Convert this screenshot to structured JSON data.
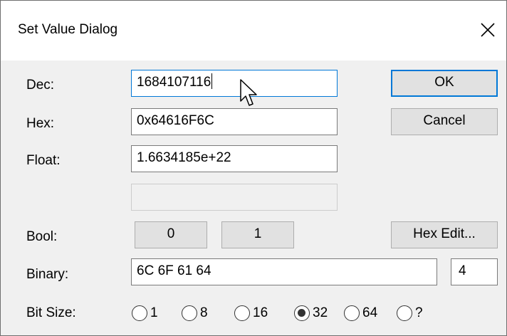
{
  "window": {
    "title": "Set Value Dialog",
    "close_icon": "close-icon"
  },
  "fields": {
    "dec": {
      "label": "Dec:",
      "value": "1684107116"
    },
    "hex": {
      "label": "Hex:",
      "value": "0x64616F6C"
    },
    "float": {
      "label": "Float:",
      "value": "1.6634185e+22"
    },
    "extra": {
      "value": ""
    },
    "bool": {
      "label": "Bool:",
      "false_label": "0",
      "true_label": "1"
    },
    "binary": {
      "label": "Binary:",
      "value": "6C 6F 61 64",
      "size": "4"
    },
    "bit_size": {
      "label": "Bit Size:",
      "options": [
        "1",
        "8",
        "16",
        "32",
        "64",
        "?"
      ],
      "selected": "32"
    }
  },
  "buttons": {
    "ok": "OK",
    "cancel": "Cancel",
    "hex_edit": "Hex Edit..."
  },
  "colors": {
    "dialog_bg": "#f0f0f0",
    "titlebar_bg": "#ffffff",
    "focus_accent": "#0078d7",
    "button_bg": "#e1e1e1"
  },
  "icons": {
    "pointer": "mouse-pointer-icon",
    "radio": "radio-button-icon"
  }
}
